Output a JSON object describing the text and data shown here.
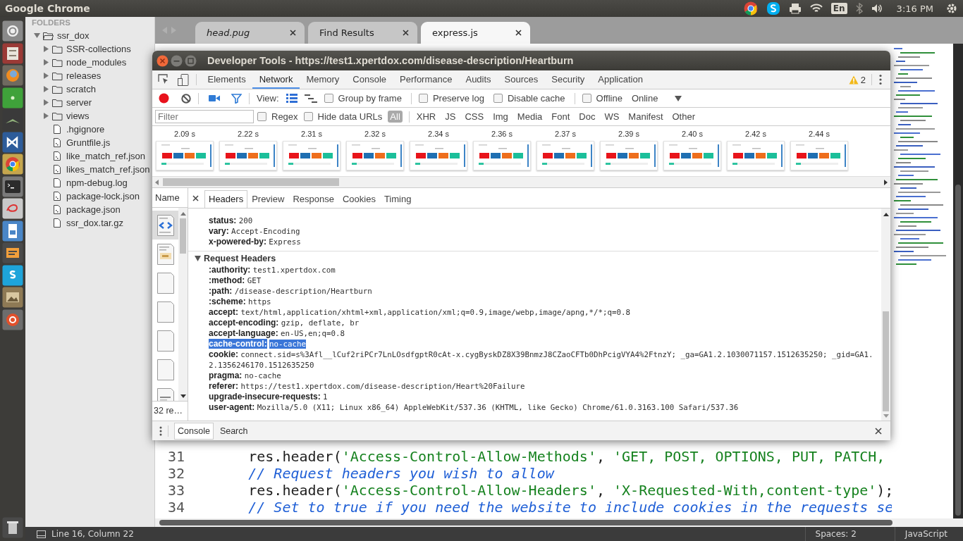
{
  "top_bar": {
    "title": "Google Chrome",
    "keyboard": "En",
    "clock": "3:16 PM"
  },
  "sidebar": {
    "heading": "FOLDERS",
    "tree": [
      {
        "name": "ssr_dox",
        "kind": "folder",
        "expanded": true,
        "children": [
          {
            "name": "SSR-collections",
            "kind": "folder",
            "expanded": false
          },
          {
            "name": "node_modules",
            "kind": "folder",
            "expanded": false
          },
          {
            "name": "releases",
            "kind": "folder",
            "expanded": false
          },
          {
            "name": "scratch",
            "kind": "folder",
            "expanded": false
          },
          {
            "name": "server",
            "kind": "folder",
            "expanded": false
          },
          {
            "name": "views",
            "kind": "folder",
            "expanded": false
          },
          {
            "name": ".hgignore",
            "kind": "file"
          },
          {
            "name": "Gruntfile.js",
            "kind": "code_file"
          },
          {
            "name": "like_match_ref.json",
            "kind": "code_file"
          },
          {
            "name": "likes_match_ref.json",
            "kind": "code_file"
          },
          {
            "name": "npm-debug.log",
            "kind": "file"
          },
          {
            "name": "package-lock.json",
            "kind": "code_file"
          },
          {
            "name": "package.json",
            "kind": "code_file"
          },
          {
            "name": "ssr_dox.tar.gz",
            "kind": "file"
          }
        ]
      }
    ]
  },
  "editor": {
    "tabs": [
      {
        "label": "head.pug",
        "selected": false,
        "preview": true
      },
      {
        "label": "Find Results",
        "selected": false,
        "preview": false
      },
      {
        "label": "express.js",
        "selected": true,
        "preview": false
      }
    ],
    "lines": [
      {
        "number": "31",
        "tokens": [
          {
            "kind": "plain",
            "text": "      res.header("
          },
          {
            "kind": "string",
            "text": "'Access-Control-Allow-Methods'"
          },
          {
            "kind": "plain",
            "text": ", "
          },
          {
            "kind": "string",
            "text": "'GET, POST, OPTIONS, PUT, PATCH,"
          }
        ]
      },
      {
        "number": "32",
        "tokens": [
          {
            "kind": "comment",
            "text": "      // Request headers you wish to allow"
          }
        ]
      },
      {
        "number": "33",
        "tokens": [
          {
            "kind": "plain",
            "text": "      res.header("
          },
          {
            "kind": "string",
            "text": "'Access-Control-Allow-Headers'"
          },
          {
            "kind": "plain",
            "text": ", "
          },
          {
            "kind": "string",
            "text": "'X-Requested-With,content-type'"
          },
          {
            "kind": "plain",
            "text": ");"
          }
        ]
      },
      {
        "number": "34",
        "tokens": [
          {
            "kind": "comment",
            "text": "      // Set to true if you need the website to include cookies in the requests se"
          }
        ]
      }
    ]
  },
  "status_bar": {
    "position": "Line 16, Column 22",
    "indentation": "Spaces: 2",
    "syntax": "JavaScript"
  },
  "devtools": {
    "title": "Developer Tools - https://test1.xpertdox.com/disease-description/Heartburn",
    "tabs": [
      {
        "label": "Elements",
        "selected": false
      },
      {
        "label": "Network",
        "selected": true
      },
      {
        "label": "Memory",
        "selected": false
      },
      {
        "label": "Console",
        "selected": false
      },
      {
        "label": "Performance",
        "selected": false
      },
      {
        "label": "Audits",
        "selected": false
      },
      {
        "label": "Sources",
        "selected": false
      },
      {
        "label": "Security",
        "selected": false
      },
      {
        "label": "Application",
        "selected": false
      }
    ],
    "warnings": "2",
    "toolbar": {
      "recording": true,
      "screenshots": true,
      "filter_bar": true,
      "view_label": "View:",
      "view_modes": [
        {
          "kind": "rows",
          "selected": true
        },
        {
          "kind": "waterfall",
          "selected": false
        }
      ],
      "options": [
        {
          "label": "Group by frame",
          "checked": false
        },
        {
          "label": "Preserve log",
          "checked": false
        },
        {
          "label": "Disable cache",
          "checked": false
        },
        {
          "label": "Offline",
          "checked": false
        }
      ],
      "throttling": "Online"
    },
    "filter": {
      "placeholder": "Filter",
      "options": [
        {
          "label": "Regex",
          "checked": false
        },
        {
          "label": "Hide data URLs",
          "checked": false
        }
      ],
      "types": [
        {
          "label": "All",
          "selected": true
        },
        {
          "label": "XHR",
          "selected": false
        },
        {
          "label": "JS",
          "selected": false
        },
        {
          "label": "CSS",
          "selected": false
        },
        {
          "label": "Img",
          "selected": false
        },
        {
          "label": "Media",
          "selected": false
        },
        {
          "label": "Font",
          "selected": false
        },
        {
          "label": "Doc",
          "selected": false
        },
        {
          "label": "WS",
          "selected": false
        },
        {
          "label": "Manifest",
          "selected": false
        },
        {
          "label": "Other",
          "selected": false
        }
      ]
    },
    "filmstrip": [
      {
        "time": "2.09 s"
      },
      {
        "time": "2.22 s"
      },
      {
        "time": "2.31 s"
      },
      {
        "time": "2.32 s"
      },
      {
        "time": "2.34 s"
      },
      {
        "time": "2.36 s"
      },
      {
        "time": "2.37 s"
      },
      {
        "time": "2.39 s"
      },
      {
        "time": "2.40 s"
      },
      {
        "time": "2.42 s"
      },
      {
        "time": "2.44 s"
      }
    ],
    "requests": {
      "heading": "Name",
      "count": "32 re…",
      "items": [
        {
          "kind": "html",
          "selected": true
        },
        {
          "kind": "script",
          "selected": false
        },
        {
          "kind": "blank",
          "selected": false
        },
        {
          "kind": "blank",
          "selected": false
        },
        {
          "kind": "blank",
          "selected": false
        },
        {
          "kind": "blank",
          "selected": false
        },
        {
          "kind": "image",
          "selected": false
        }
      ]
    },
    "detail": {
      "tabs": [
        {
          "label": "Headers",
          "selected": true
        },
        {
          "label": "Preview",
          "selected": false
        },
        {
          "label": "Response",
          "selected": false
        },
        {
          "label": "Cookies",
          "selected": false
        },
        {
          "label": "Timing",
          "selected": false
        }
      ],
      "response_headers": [
        {
          "name": "status:",
          "value": "200",
          "selected": false
        },
        {
          "name": "vary:",
          "value": "Accept-Encoding",
          "selected": false
        },
        {
          "name": "x-powered-by:",
          "value": "Express",
          "selected": false
        }
      ],
      "request_headers": {
        "title": "Request Headers",
        "expanded": true,
        "rows": [
          {
            "name": ":authority:",
            "value": "test1.xpertdox.com",
            "selected": false
          },
          {
            "name": ":method:",
            "value": "GET",
            "selected": false
          },
          {
            "name": ":path:",
            "value": "/disease-description/Heartburn",
            "selected": false
          },
          {
            "name": ":scheme:",
            "value": "https",
            "selected": false
          },
          {
            "name": "accept:",
            "value": "text/html,application/xhtml+xml,application/xml;q=0.9,image/webp,image/apng,*/*;q=0.8",
            "selected": false
          },
          {
            "name": "accept-encoding:",
            "value": "gzip, deflate, br",
            "selected": false
          },
          {
            "name": "accept-language:",
            "value": "en-US,en;q=0.8",
            "selected": false
          },
          {
            "name": "cache-control:",
            "value": "no-cache",
            "selected": true
          },
          {
            "name": "cookie:",
            "value": "connect.sid=s%3Afl__lCuf2riPCr7LnLOsdfgptR0cAt-x.cygByskDZ8X39BnmzJ8CZaoCFTb0DhPcigVYA4%2FtnzY; _ga=GA1.2.1030071157.1512635250; _gid=GA1.2.1356246170.1512635250",
            "selected": false
          },
          {
            "name": "pragma:",
            "value": "no-cache",
            "selected": false
          },
          {
            "name": "referer:",
            "value": "https://test1.xpertdox.com/disease-description/Heart%20Failure",
            "selected": false
          },
          {
            "name": "upgrade-insecure-requests:",
            "value": "1",
            "selected": false
          },
          {
            "name": "user-agent:",
            "value": "Mozilla/5.0 (X11; Linux x86_64) AppleWebKit/537.36 (KHTML, like Gecko) Chrome/61.0.3163.100 Safari/537.36",
            "selected": false
          }
        ]
      }
    },
    "drawer": {
      "tabs": [
        {
          "label": "Console",
          "selected": true
        },
        {
          "label": "Search",
          "selected": false
        }
      ]
    }
  }
}
